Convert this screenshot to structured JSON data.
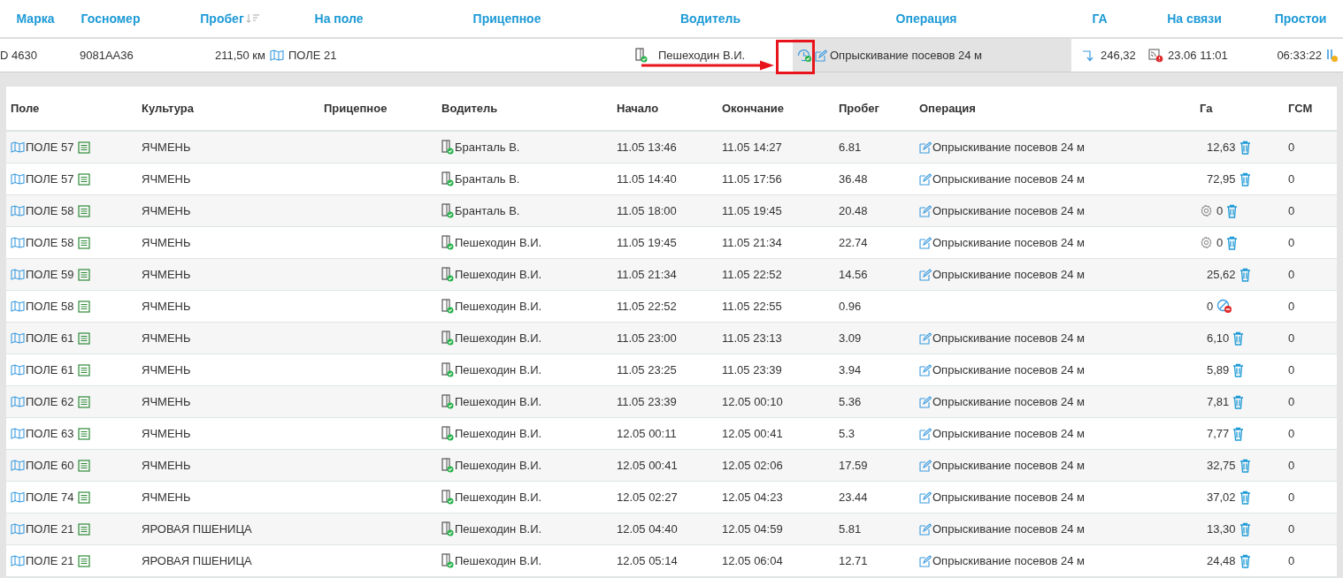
{
  "top_bar": {
    "columns": [
      {
        "label": "Марка",
        "sorted": false
      },
      {
        "label": "Госномер",
        "sorted": false
      },
      {
        "label": "Пробег",
        "sorted": true
      },
      {
        "label": "На поле",
        "sorted": false
      },
      {
        "label": "Прицепное",
        "sorted": false
      },
      {
        "label": "Водитель",
        "sorted": false
      },
      {
        "label": "Операция",
        "sorted": false
      },
      {
        "label": "ГА",
        "sorted": false
      },
      {
        "label": "На связи",
        "sorted": false
      },
      {
        "label": "Простои",
        "sorted": false
      }
    ],
    "vehicle": {
      "brand": "D 4630",
      "plate": "9081AA36",
      "mileage": "211,50 км",
      "field": "ПОЛЕ 21",
      "driver": "Пешеходин В.И.",
      "operation": "Опрыскивание посевов 24 м",
      "ha": "246,32",
      "online": "23.06 11:01",
      "idle": "06:33:22"
    }
  },
  "table": {
    "columns": [
      "Поле",
      "Культура",
      "Прицепное",
      "Водитель",
      "Начало",
      "Окончание",
      "Пробег",
      "Операция",
      "Га",
      "ГСМ"
    ],
    "rows": [
      {
        "field": "ПОЛЕ 57",
        "crop": "ЯЧМЕНЬ",
        "driver": "Бранталь В.",
        "start": "11.05 13:46",
        "end": "11.05 14:27",
        "mileage": "6.81",
        "operation": "Опрыскивание посевов 24 м",
        "ha": "12,63",
        "kind": "delete",
        "fuel": "0"
      },
      {
        "field": "ПОЛЕ 57",
        "crop": "ЯЧМЕНЬ",
        "driver": "Бранталь В.",
        "start": "11.05 14:40",
        "end": "11.05 17:56",
        "mileage": "36.48",
        "operation": "Опрыскивание посевов 24 м",
        "ha": "72,95",
        "kind": "delete",
        "fuel": "0"
      },
      {
        "field": "ПОЛЕ 58",
        "crop": "ЯЧМЕНЬ",
        "driver": "Бранталь В.",
        "start": "11.05 18:00",
        "end": "11.05 19:45",
        "mileage": "20.48",
        "operation": "Опрыскивание посевов 24 м",
        "ha": "0",
        "kind": "gear",
        "fuel": "0"
      },
      {
        "field": "ПОЛЕ 58",
        "crop": "ЯЧМЕНЬ",
        "driver": "Пешеходин В.И.",
        "start": "11.05 19:45",
        "end": "11.05 21:34",
        "mileage": "22.74",
        "operation": "Опрыскивание посевов 24 м",
        "ha": "0",
        "kind": "gear",
        "fuel": "0"
      },
      {
        "field": "ПОЛЕ 59",
        "crop": "ЯЧМЕНЬ",
        "driver": "Пешеходин В.И.",
        "start": "11.05 21:34",
        "end": "11.05 22:52",
        "mileage": "14.56",
        "operation": "Опрыскивание посевов 24 м",
        "ha": "25,62",
        "kind": "delete",
        "fuel": "0"
      },
      {
        "field": "ПОЛЕ 58",
        "crop": "ЯЧМЕНЬ",
        "driver": "Пешеходин В.И.",
        "start": "11.05 22:52",
        "end": "11.05 22:55",
        "mileage": "0.96",
        "ha": "0",
        "kind": "blocked",
        "fuel": "0"
      },
      {
        "field": "ПОЛЕ 61",
        "crop": "ЯЧМЕНЬ",
        "driver": "Пешеходин В.И.",
        "start": "11.05 23:00",
        "end": "11.05 23:13",
        "mileage": "3.09",
        "operation": "Опрыскивание посевов 24 м",
        "ha": "6,10",
        "kind": "delete",
        "fuel": "0"
      },
      {
        "field": "ПОЛЕ 61",
        "crop": "ЯЧМЕНЬ",
        "driver": "Пешеходин В.И.",
        "start": "11.05 23:25",
        "end": "11.05 23:39",
        "mileage": "3.94",
        "operation": "Опрыскивание посевов 24 м",
        "ha": "5,89",
        "kind": "delete",
        "fuel": "0"
      },
      {
        "field": "ПОЛЕ 62",
        "crop": "ЯЧМЕНЬ",
        "driver": "Пешеходин В.И.",
        "start": "11.05 23:39",
        "end": "12.05 00:10",
        "mileage": "5.36",
        "operation": "Опрыскивание посевов 24 м",
        "ha": "7,81",
        "kind": "delete",
        "fuel": "0"
      },
      {
        "field": "ПОЛЕ 63",
        "crop": "ЯЧМЕНЬ",
        "driver": "Пешеходин В.И.",
        "start": "12.05 00:11",
        "end": "12.05 00:41",
        "mileage": "5.3",
        "operation": "Опрыскивание посевов 24 м",
        "ha": "7,77",
        "kind": "delete",
        "fuel": "0"
      },
      {
        "field": "ПОЛЕ 60",
        "crop": "ЯЧМЕНЬ",
        "driver": "Пешеходин В.И.",
        "start": "12.05 00:41",
        "end": "12.05 02:06",
        "mileage": "17.59",
        "operation": "Опрыскивание посевов 24 м",
        "ha": "32,75",
        "kind": "delete",
        "fuel": "0"
      },
      {
        "field": "ПОЛЕ 74",
        "crop": "ЯЧМЕНЬ",
        "driver": "Пешеходин В.И.",
        "start": "12.05 02:27",
        "end": "12.05 04:23",
        "mileage": "23.44",
        "operation": "Опрыскивание посевов 24 м",
        "ha": "37,02",
        "kind": "delete",
        "fuel": "0"
      },
      {
        "field": "ПОЛЕ 21",
        "crop": "ЯРОВАЯ ПШЕНИЦА",
        "driver": "Пешеходин В.И.",
        "start": "12.05 04:40",
        "end": "12.05 04:59",
        "mileage": "5.81",
        "operation": "Опрыскивание посевов 24 м",
        "ha": "13,30",
        "kind": "delete",
        "fuel": "0"
      },
      {
        "field": "ПОЛЕ 21",
        "crop": "ЯРОВАЯ ПШЕНИЦА",
        "driver": "Пешеходин В.И.",
        "start": "12.05 05:14",
        "end": "12.05 06:04",
        "mileage": "12.71",
        "operation": "Опрыскивание посевов 24 м",
        "ha": "24,48",
        "kind": "delete",
        "fuel": "0"
      }
    ]
  }
}
